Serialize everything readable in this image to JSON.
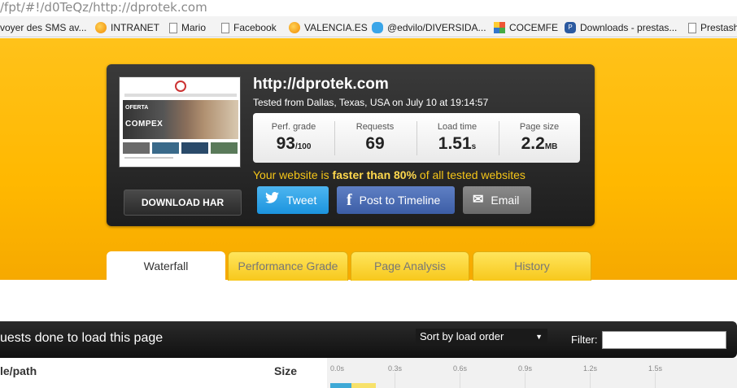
{
  "browser": {
    "url": "/fpt/#!/d0TeQz/http://dprotek.com",
    "bookmarks": [
      {
        "label": "voyer des SMS av...",
        "icon": "none"
      },
      {
        "label": "INTRANET",
        "icon": "orange-globe-icon"
      },
      {
        "label": "Mario",
        "icon": "page-icon"
      },
      {
        "label": "Facebook",
        "icon": "page-icon"
      },
      {
        "label": "VALENCIA.ES",
        "icon": "orange-globe-icon"
      },
      {
        "label": "@edvilo/DIVERSIDA...",
        "icon": "twitter-icon"
      },
      {
        "label": "COCEMFE",
        "icon": "cocemfe-icon"
      },
      {
        "label": "Downloads - prestas...",
        "icon": "prestashop-icon"
      },
      {
        "label": "Prestash",
        "icon": "page-icon"
      }
    ]
  },
  "result": {
    "site": "http://dprotek.com",
    "tested": "Tested from Dallas, Texas, USA on July 10 at 19:14:57",
    "download_har": "DOWNLOAD HAR",
    "thumbnail": {
      "oferta": "OFERTA",
      "brand": "COMPEX"
    },
    "stats": [
      {
        "label": "Perf. grade",
        "value": "93",
        "unit": "/100"
      },
      {
        "label": "Requests",
        "value": "69",
        "unit": ""
      },
      {
        "label": "Load time",
        "value": "1.51",
        "unit": "s"
      },
      {
        "label": "Page size",
        "value": "2.2",
        "unit": "MB"
      }
    ],
    "faster": {
      "pre": "Your website is ",
      "bold": "faster than 80%",
      "post": " of all tested websites"
    },
    "share": {
      "tweet": "Tweet",
      "facebook": "Post to Timeline",
      "email": "Email"
    }
  },
  "tabs": [
    "Waterfall",
    "Performance Grade",
    "Page Analysis",
    "History"
  ],
  "active_tab": "Waterfall",
  "requests": {
    "title": "uests done to load this page",
    "sort": "Sort by load order",
    "filter_label": "Filter:",
    "filter_value": "",
    "col_path": "le/path",
    "col_size": "Size",
    "ticks": [
      "0.0s",
      "0.3s",
      "0.6s",
      "0.9s",
      "1.2s",
      "1.5s"
    ]
  },
  "colors": {
    "accent": "#ffb800",
    "tweet": "#1c94de",
    "facebook": "#3d5ea6",
    "highlight": "#f5c518"
  }
}
